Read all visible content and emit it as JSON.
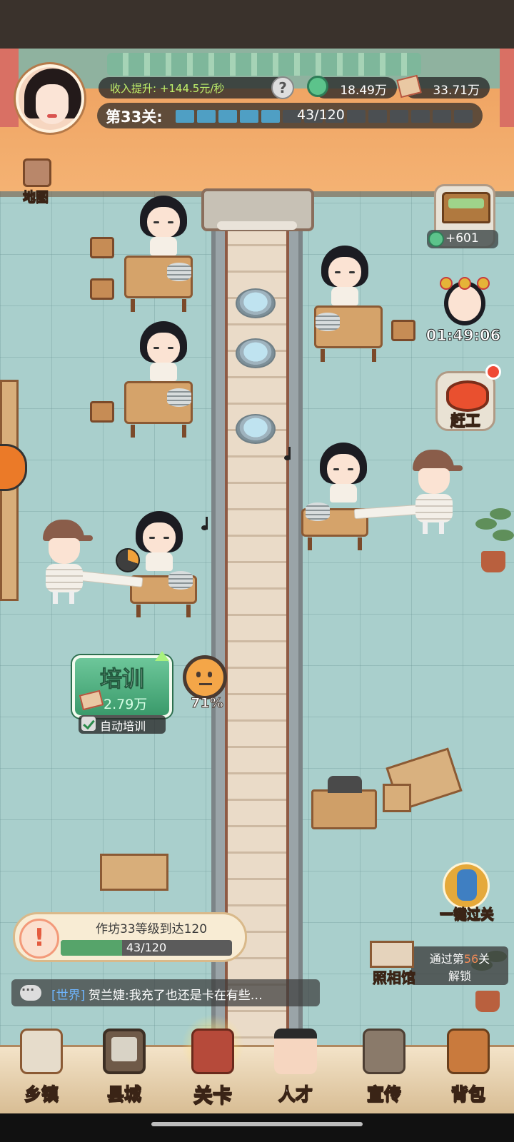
{
  "hud": {
    "income_text": "收入提升: +144.5元/秒",
    "help_label": "?",
    "gems": "18.49万",
    "cash": "33.71万",
    "level_label": "第33关:",
    "level_progress": "43/120",
    "level_segments_total": 14,
    "level_segments_filled": 5
  },
  "side": {
    "map_label": "地图",
    "chest_reward": "+601",
    "event_timer": "01:49:06",
    "rush_label": "赶工",
    "skip_label": "一键过关"
  },
  "training": {
    "title": "培训",
    "cost": "2.79万",
    "auto_label": "自动培训",
    "auto_checked": true,
    "mood_percent": "71%"
  },
  "quest": {
    "text": "作坊33等级到达120",
    "progress_text": "43/120",
    "progress_fraction": 0.358
  },
  "photo_studio": {
    "name": "照相馆",
    "unlock_prefix": "通过第",
    "unlock_level": "56",
    "unlock_suffix": "关",
    "unlock_line2": "解锁"
  },
  "chat": {
    "channel": "[世界]",
    "message": "贺兰婕:我充了也还是卡在有些…"
  },
  "nav": [
    {
      "label": "乡镇",
      "icon": "town-icon",
      "active": false
    },
    {
      "label": "县城",
      "icon": "county-tv-icon",
      "active": false
    },
    {
      "label": "关卡",
      "icon": "level-sewing-icon",
      "active": true
    },
    {
      "label": "人才",
      "icon": "talent-icon",
      "active": false
    },
    {
      "label": "宣传",
      "icon": "promo-camera-icon",
      "active": false
    },
    {
      "label": "背包",
      "icon": "backpack-icon",
      "active": false
    }
  ],
  "colors": {
    "accent_green": "#56a46a",
    "income_green": "#bff06b",
    "progress_blue": "#4f9fc4",
    "alert_red": "#ef4a36"
  }
}
